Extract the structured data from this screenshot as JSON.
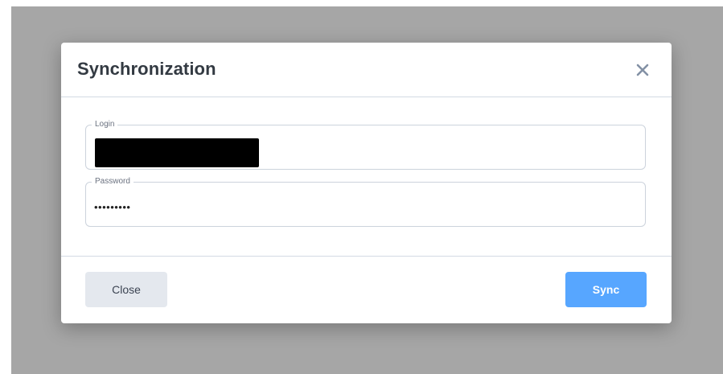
{
  "dialog": {
    "title": "Synchronization",
    "close_icon": "close-icon"
  },
  "form": {
    "login": {
      "label": "Login",
      "value": ""
    },
    "password": {
      "label": "Password",
      "value": "•••••••••"
    }
  },
  "footer": {
    "close_label": "Close",
    "sync_label": "Sync"
  },
  "colors": {
    "backdrop": "#a6a6a6",
    "primary": "#57a6ff",
    "secondary_button": "#e4e8ee",
    "divider": "#d3dae3"
  }
}
